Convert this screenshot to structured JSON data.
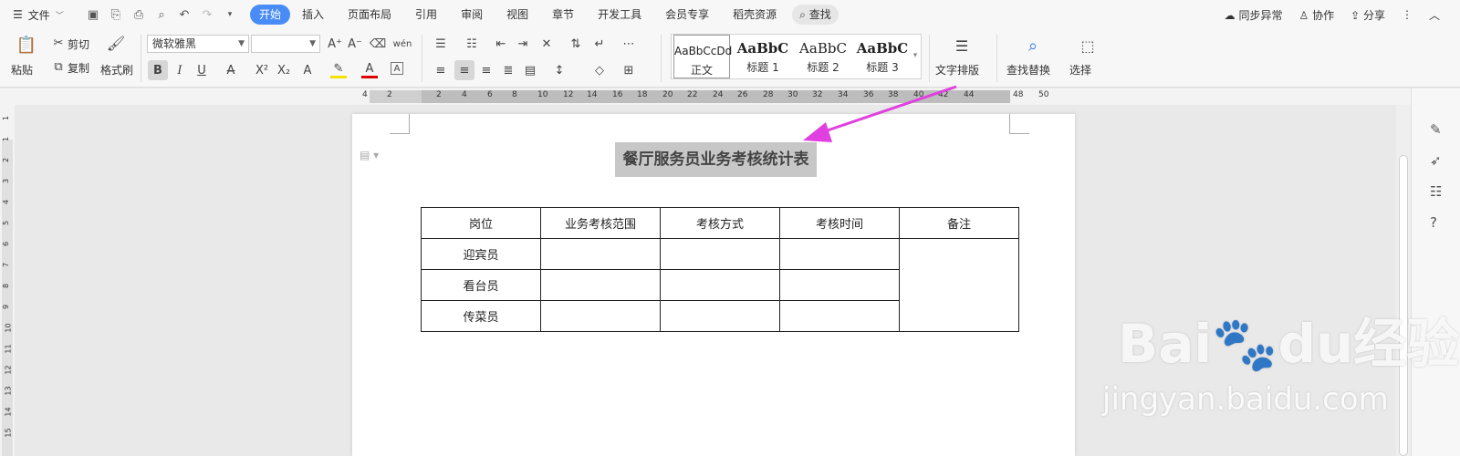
{
  "menubar": {
    "file_label": "文件",
    "tabs": [
      "开始",
      "插入",
      "页面布局",
      "引用",
      "审阅",
      "视图",
      "章节",
      "开发工具",
      "会员专享",
      "稻壳资源"
    ],
    "search_label": "查找",
    "sync": "同步异常",
    "collab": "协作",
    "share": "分享"
  },
  "ribbon": {
    "paste": "粘贴",
    "cut": "剪切",
    "copy": "复制",
    "format_painter": "格式刷",
    "font_name": "微软雅黑",
    "font_size": "",
    "bold": "B",
    "italic": "I",
    "underline": "U",
    "styles": [
      {
        "preview": "AaBbCcDd",
        "name": "正文"
      },
      {
        "preview": "AaBbC",
        "name": "标题 1"
      },
      {
        "preview": "AaBbC",
        "name": "标题 2"
      },
      {
        "preview": "AaBbC",
        "name": "标题 3"
      }
    ],
    "text_layout": "文字排版",
    "find_replace": "查找替换",
    "select": "选择"
  },
  "ruler": {
    "ticks": [
      "4",
      "2",
      "2",
      "4",
      "6",
      "8",
      "10",
      "12",
      "14",
      "16",
      "18",
      "20",
      "22",
      "24",
      "26",
      "28",
      "30",
      "32",
      "34",
      "36",
      "38",
      "40",
      "42",
      "44",
      "48",
      "50"
    ],
    "vticks": [
      "1",
      "1",
      "2",
      "3",
      "4",
      "5",
      "6",
      "7",
      "8",
      "9",
      "10",
      "11",
      "12",
      "13",
      "14",
      "15"
    ]
  },
  "document": {
    "title": "餐厅服务员业务考核统计表",
    "headers": [
      "岗位",
      "业务考核范围",
      "考核方式",
      "考核时间",
      "备注"
    ],
    "rows": [
      [
        "迎宾员",
        "",
        "",
        ""
      ],
      [
        "看台员",
        "",
        "",
        ""
      ],
      [
        "传菜员",
        "",
        "",
        ""
      ]
    ]
  },
  "watermark": {
    "brand": "Bai",
    "brand2": "经验",
    "url": "jingyan.baidu.com"
  },
  "colors": {
    "accent": "#4a8cf7",
    "arrow": "#e040e0",
    "title_highlight": "#c7c7c7"
  }
}
